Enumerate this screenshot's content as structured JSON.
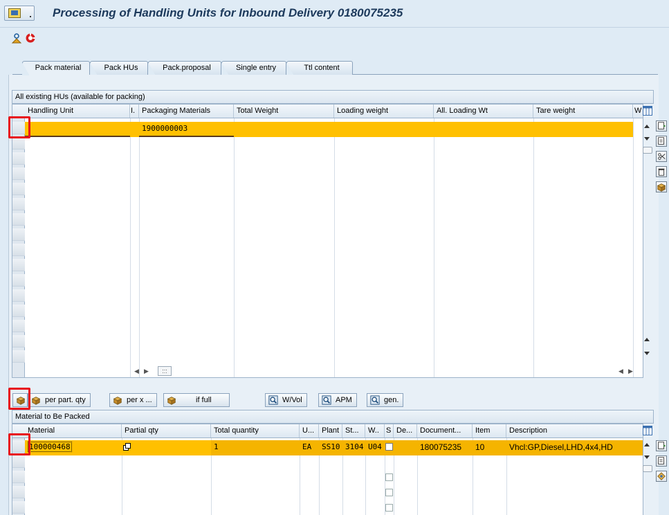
{
  "window": {
    "title": "Processing of Handling Units for Inbound Delivery 0180075235"
  },
  "icons": {
    "menu": "sap-menu-icon",
    "app1": "person-icon",
    "app2": "lifebuoy-icon",
    "pack": "box-icon",
    "find": "find-icon"
  },
  "tabs": [
    {
      "label": "Pack material",
      "active": true
    },
    {
      "label": "Pack HUs",
      "active": false
    },
    {
      "label": "Pack.proposal",
      "active": false
    },
    {
      "label": "Single entry",
      "active": false
    },
    {
      "label": "Ttl content",
      "active": false
    }
  ],
  "hu_grid": {
    "title": "All existing HUs (available for packing)",
    "columns": [
      "Handling Unit",
      "I.",
      "Packaging Materials",
      "Total Weight",
      "Loading weight",
      "All. Loading Wt",
      "Tare weight",
      "W"
    ],
    "rows": [
      {
        "handling_unit": "",
        "i": "",
        "packaging_materials": "1900000003",
        "total_weight": "",
        "loading_weight": "",
        "all_loading_wt": "",
        "tare_weight": ""
      }
    ],
    "hscroll_icon": ":::"
  },
  "pack_buttons": {
    "per_part_qty": "per part. qty",
    "per_x": "per x ...",
    "if_full": "if full",
    "wvol": "W/Vol",
    "apm": "APM",
    "gen": "gen."
  },
  "material_grid": {
    "title": "Material to Be Packed",
    "columns": [
      "Material",
      "Partial qty",
      "Total quantity",
      "U...",
      "Plant",
      "St...",
      "W..",
      "S",
      "De...",
      "Document...",
      "Item",
      "Description"
    ],
    "rows": [
      {
        "material": "100000468",
        "partial_qty": "",
        "total_quantity": "1",
        "unit": "EA",
        "plant": "SS10",
        "storage": "3104",
        "wh": "U04",
        "s": "",
        "de": "",
        "document": "180075235",
        "item": "10",
        "description": "Vhcl:GP,Diesel,LHD,4x4,HD"
      }
    ]
  },
  "colors": {
    "selected_row": "#ffc000",
    "material_row": "#f5b400",
    "highlight_box": "#e8101a",
    "title_text": "#1d3a5c"
  }
}
